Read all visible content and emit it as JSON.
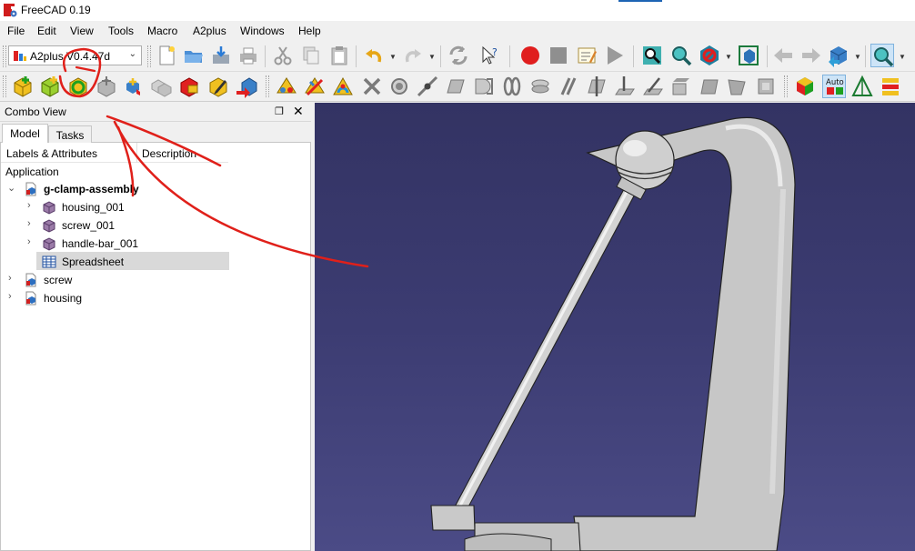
{
  "window": {
    "title": "FreeCAD 0.19"
  },
  "menu": [
    "File",
    "Edit",
    "View",
    "Tools",
    "Macro",
    "A2plus",
    "Windows",
    "Help"
  ],
  "workbench": {
    "label": "A2plus V0.4.47d"
  },
  "combo_view": {
    "title": "Combo View",
    "float_icon": "❐",
    "close_icon": "✕"
  },
  "tabs": {
    "model": "Model",
    "tasks": "Tasks"
  },
  "tree": {
    "header_col1": "Labels & Attributes",
    "header_col2": "Description",
    "root": "Application",
    "items": [
      {
        "label": "g-clamp-assembly"
      },
      {
        "label": "housing_001"
      },
      {
        "label": "screw_001"
      },
      {
        "label": "handle-bar_001"
      },
      {
        "label": "Spreadsheet"
      },
      {
        "label": "screw"
      },
      {
        "label": "housing"
      }
    ]
  },
  "toolbar": {
    "auto_label": "Auto"
  },
  "colors": {
    "view_top": "#333363",
    "view_bottom": "#4b4b86",
    "annotation": "#e0201a",
    "selection": "#d9d9d9"
  }
}
